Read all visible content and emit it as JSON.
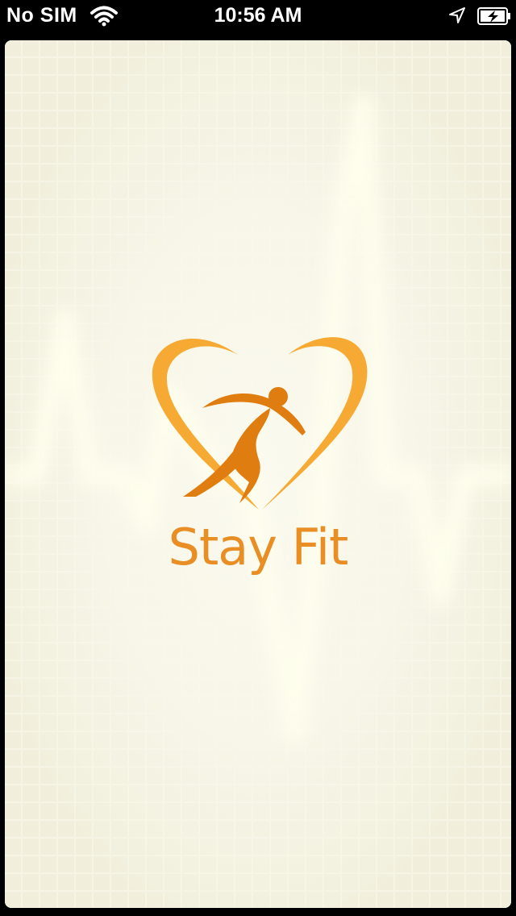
{
  "status_bar": {
    "carrier": "No SIM",
    "time": "10:56 AM",
    "icons": [
      "wifi-icon",
      "location-icon",
      "battery-charging-icon"
    ]
  },
  "splash": {
    "app_title": "Stay Fit",
    "logo": "heart-runner-logo",
    "background": "ecg-heartbeat-grid"
  },
  "colors": {
    "background": "#f6f4e4",
    "grid": "#ebe9d6",
    "heart_outer": "#f6aa34",
    "runner": "#e07d10",
    "title": "#e88e25"
  }
}
